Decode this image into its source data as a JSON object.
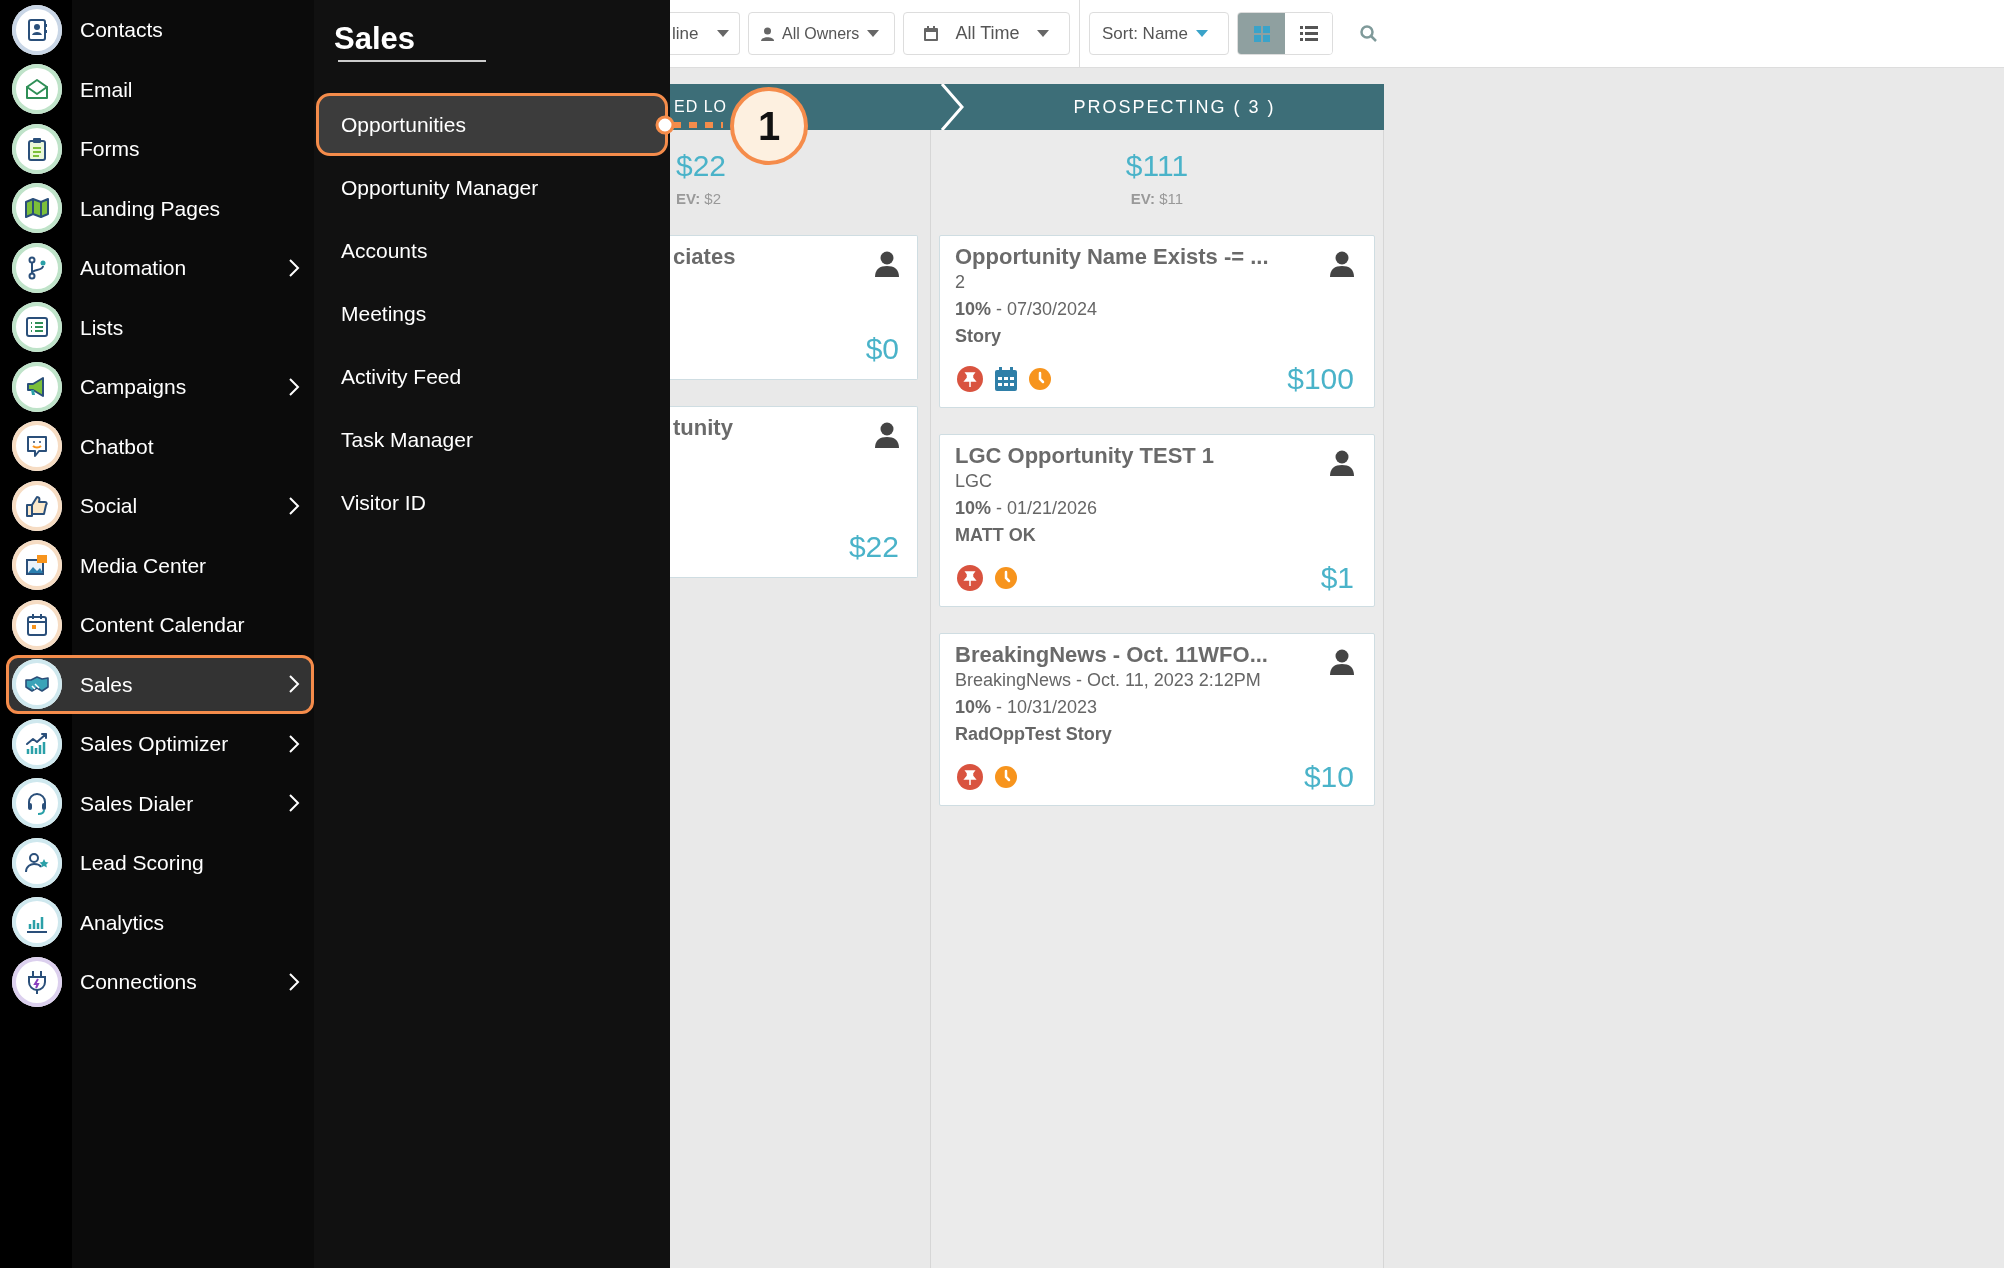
{
  "sidebar": {
    "items": [
      {
        "label": "Contacts",
        "submenu": false,
        "selected": false
      },
      {
        "label": "Email",
        "submenu": false,
        "selected": false
      },
      {
        "label": "Forms",
        "submenu": false,
        "selected": false
      },
      {
        "label": "Landing Pages",
        "submenu": false,
        "selected": false
      },
      {
        "label": "Automation",
        "submenu": true,
        "selected": false
      },
      {
        "label": "Lists",
        "submenu": false,
        "selected": false
      },
      {
        "label": "Campaigns",
        "submenu": true,
        "selected": false
      },
      {
        "label": "Chatbot",
        "submenu": false,
        "selected": false
      },
      {
        "label": "Social",
        "submenu": true,
        "selected": false
      },
      {
        "label": "Media Center",
        "submenu": false,
        "selected": false
      },
      {
        "label": "Content Calendar",
        "submenu": false,
        "selected": false
      },
      {
        "label": "Sales",
        "submenu": true,
        "selected": true
      },
      {
        "label": "Sales Optimizer",
        "submenu": true,
        "selected": false
      },
      {
        "label": "Sales Dialer",
        "submenu": true,
        "selected": false
      },
      {
        "label": "Lead Scoring",
        "submenu": false,
        "selected": false
      },
      {
        "label": "Analytics",
        "submenu": false,
        "selected": false
      },
      {
        "label": "Connections",
        "submenu": true,
        "selected": false
      }
    ]
  },
  "submenu": {
    "title": "Sales",
    "items": [
      {
        "label": "Opportunities",
        "selected": true
      },
      {
        "label": "Opportunity Manager",
        "selected": false
      },
      {
        "label": "Accounts",
        "selected": false
      },
      {
        "label": "Meetings",
        "selected": false
      },
      {
        "label": "Activity Feed",
        "selected": false
      },
      {
        "label": "Task Manager",
        "selected": false
      },
      {
        "label": "Visitor ID",
        "selected": false
      }
    ]
  },
  "callout": {
    "number": "1"
  },
  "toolbar": {
    "pipeline": "line",
    "owners": "All Owners",
    "time": "All Time",
    "sort": "Sort: Name",
    "views": [
      {
        "kind": "grid",
        "selected": true
      },
      {
        "kind": "list",
        "selected": false
      }
    ]
  },
  "columns": [
    {
      "kind": "clipped",
      "header": "ED LO",
      "total": "$22",
      "ev": "**EV:** $2",
      "cards": [
        {
          "title": "ciates",
          "amount": "$0"
        },
        {
          "title": "tunity",
          "amount": "$22"
        }
      ]
    },
    {
      "kind": "full",
      "header": "PROSPECTING ( 3 )",
      "total": "$111",
      "ev": "**EV:** $11",
      "cards": [
        {
          "title": "Opportunity Name Exists -= ...",
          "subtitle": "2",
          "stage": "**10%** - 07/30/2024",
          "owner": "Story",
          "amount": "$100",
          "icons": [
            {
              "kind": "pin"
            },
            {
              "kind": "calendar"
            },
            {
              "kind": "clock"
            }
          ]
        },
        {
          "title": "LGC Opportunity TEST 1",
          "subtitle": "LGC",
          "stage": "**10%** - 01/21/2026",
          "owner": "MATT OK",
          "amount": "$1",
          "icons": [
            {
              "kind": "pin"
            },
            {
              "kind": "clock"
            }
          ]
        },
        {
          "title": "BreakingNews - Oct. 11WFO...",
          "subtitle": "BreakingNews - Oct. 11, 2023 2:12PM",
          "stage": "**10%** - 10/31/2023",
          "owner": "RadOppTest Story",
          "amount": "$10",
          "icons": [
            {
              "kind": "pin"
            },
            {
              "kind": "clock"
            }
          ]
        }
      ]
    }
  ]
}
